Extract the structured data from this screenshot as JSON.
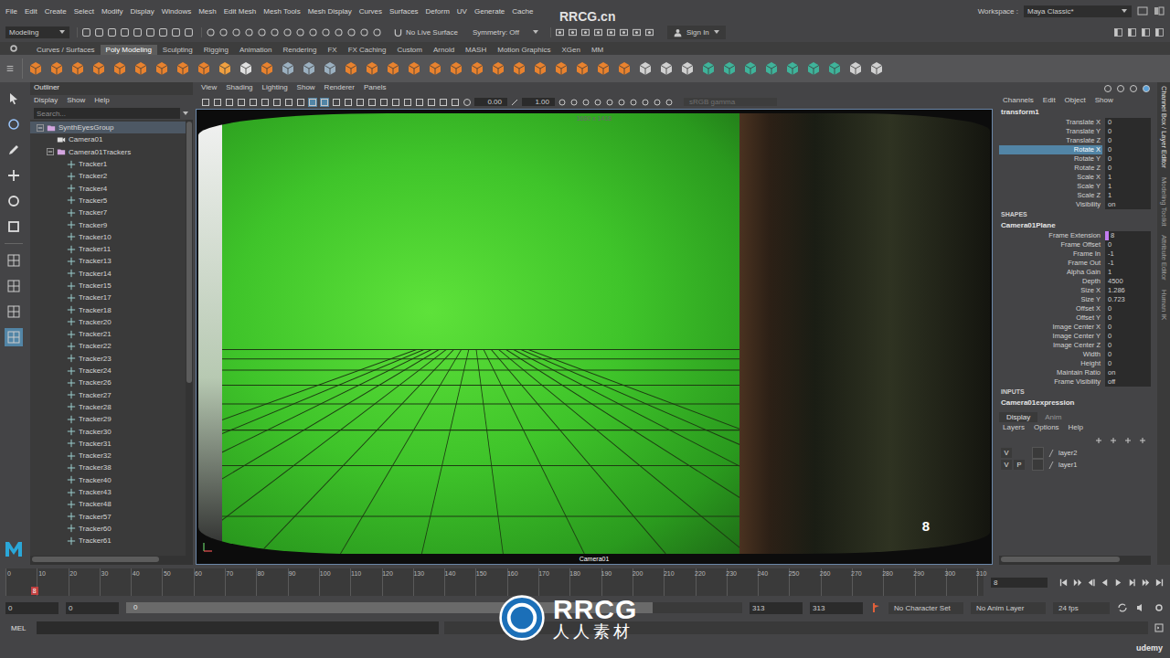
{
  "menubar": {
    "items": [
      "File",
      "Edit",
      "Create",
      "Select",
      "Modify",
      "Display",
      "Windows",
      "Mesh",
      "Edit Mesh",
      "Mesh Tools",
      "Mesh Display",
      "Curves",
      "Surfaces",
      "Deform",
      "UV",
      "Generate",
      "Cache"
    ],
    "workspace_label": "Workspace :",
    "workspace": "Maya Classic*"
  },
  "statusline": {
    "mode": "Modeling",
    "live_surface": "No Live Surface",
    "symmetry": "Symmetry: Off",
    "sign_in": "Sign In"
  },
  "shelf_tabs": [
    {
      "label": "Curves / Surfaces",
      "selected": false
    },
    {
      "label": "Poly Modeling",
      "selected": true
    },
    {
      "label": "Sculpting",
      "selected": false
    },
    {
      "label": "Rigging",
      "selected": false
    },
    {
      "label": "Animation",
      "selected": false
    },
    {
      "label": "Rendering",
      "selected": false
    },
    {
      "label": "FX",
      "selected": false
    },
    {
      "label": "FX Caching",
      "selected": false
    },
    {
      "label": "Custom",
      "selected": false
    },
    {
      "label": "Arnold",
      "selected": false
    },
    {
      "label": "MASH",
      "selected": false
    },
    {
      "label": "Motion Graphics",
      "selected": false
    },
    {
      "label": "XGen",
      "selected": false
    },
    {
      "label": "MM",
      "selected": false
    }
  ],
  "outliner": {
    "title": "Outliner",
    "menu": [
      "Display",
      "Show",
      "Help"
    ],
    "search_placeholder": "Search...",
    "items": [
      {
        "label": "SynthEyesGroup",
        "depth": 0,
        "kind": "group",
        "expanded": true,
        "selected": true
      },
      {
        "label": "Camera01",
        "depth": 1,
        "kind": "camera",
        "expanded": false,
        "selected": false
      },
      {
        "label": "Camera01Trackers",
        "depth": 1,
        "kind": "group",
        "expanded": true,
        "selected": false
      },
      {
        "label": "Tracker1",
        "depth": 2,
        "kind": "locator",
        "expanded": false,
        "selected": false
      },
      {
        "label": "Tracker2",
        "depth": 2,
        "kind": "locator",
        "expanded": false,
        "selected": false
      },
      {
        "label": "Tracker4",
        "depth": 2,
        "kind": "locator",
        "expanded": false,
        "selected": false
      },
      {
        "label": "Tracker5",
        "depth": 2,
        "kind": "locator",
        "expanded": false,
        "selected": false
      },
      {
        "label": "Tracker7",
        "depth": 2,
        "kind": "locator",
        "expanded": false,
        "selected": false
      },
      {
        "label": "Tracker9",
        "depth": 2,
        "kind": "locator",
        "expanded": false,
        "selected": false
      },
      {
        "label": "Tracker10",
        "depth": 2,
        "kind": "locator",
        "expanded": false,
        "selected": false
      },
      {
        "label": "Tracker11",
        "depth": 2,
        "kind": "locator",
        "expanded": false,
        "selected": false
      },
      {
        "label": "Tracker13",
        "depth": 2,
        "kind": "locator",
        "expanded": false,
        "selected": false
      },
      {
        "label": "Tracker14",
        "depth": 2,
        "kind": "locator",
        "expanded": false,
        "selected": false
      },
      {
        "label": "Tracker15",
        "depth": 2,
        "kind": "locator",
        "expanded": false,
        "selected": false
      },
      {
        "label": "Tracker17",
        "depth": 2,
        "kind": "locator",
        "expanded": false,
        "selected": false
      },
      {
        "label": "Tracker18",
        "depth": 2,
        "kind": "locator",
        "expanded": false,
        "selected": false
      },
      {
        "label": "Tracker20",
        "depth": 2,
        "kind": "locator",
        "expanded": false,
        "selected": false
      },
      {
        "label": "Tracker21",
        "depth": 2,
        "kind": "locator",
        "expanded": false,
        "selected": false
      },
      {
        "label": "Tracker22",
        "depth": 2,
        "kind": "locator",
        "expanded": false,
        "selected": false
      },
      {
        "label": "Tracker23",
        "depth": 2,
        "kind": "locator",
        "expanded": false,
        "selected": false
      },
      {
        "label": "Tracker24",
        "depth": 2,
        "kind": "locator",
        "expanded": false,
        "selected": false
      },
      {
        "label": "Tracker26",
        "depth": 2,
        "kind": "locator",
        "expanded": false,
        "selected": false
      },
      {
        "label": "Tracker27",
        "depth": 2,
        "kind": "locator",
        "expanded": false,
        "selected": false
      },
      {
        "label": "Tracker28",
        "depth": 2,
        "kind": "locator",
        "expanded": false,
        "selected": false
      },
      {
        "label": "Tracker29",
        "depth": 2,
        "kind": "locator",
        "expanded": false,
        "selected": false
      },
      {
        "label": "Tracker30",
        "depth": 2,
        "kind": "locator",
        "expanded": false,
        "selected": false
      },
      {
        "label": "Tracker31",
        "depth": 2,
        "kind": "locator",
        "expanded": false,
        "selected": false
      },
      {
        "label": "Tracker32",
        "depth": 2,
        "kind": "locator",
        "expanded": false,
        "selected": false
      },
      {
        "label": "Tracker38",
        "depth": 2,
        "kind": "locator",
        "expanded": false,
        "selected": false
      },
      {
        "label": "Tracker40",
        "depth": 2,
        "kind": "locator",
        "expanded": false,
        "selected": false
      },
      {
        "label": "Tracker43",
        "depth": 2,
        "kind": "locator",
        "expanded": false,
        "selected": false
      },
      {
        "label": "Tracker48",
        "depth": 2,
        "kind": "locator",
        "expanded": false,
        "selected": false
      },
      {
        "label": "Tracker57",
        "depth": 2,
        "kind": "locator",
        "expanded": false,
        "selected": false
      },
      {
        "label": "Tracker60",
        "depth": 2,
        "kind": "locator",
        "expanded": false,
        "selected": false
      },
      {
        "label": "Tracker61",
        "depth": 2,
        "kind": "locator",
        "expanded": false,
        "selected": false
      }
    ]
  },
  "viewport": {
    "menu": [
      "View",
      "Shading",
      "Lighting",
      "Show",
      "Renderer",
      "Panels"
    ],
    "exposure": "0.00",
    "gamma": "1.00",
    "color_space": "sRGB gamma",
    "resolution": "1680 x 1418",
    "camera": "Camera01",
    "frame": "8"
  },
  "channel_box": {
    "menu": [
      "Channels",
      "Edit",
      "Object",
      "Show"
    ],
    "node": "transform1",
    "attributes": [
      {
        "name": "Translate X",
        "value": "0",
        "selected": false,
        "driven": false
      },
      {
        "name": "Translate Y",
        "value": "0",
        "selected": false,
        "driven": false
      },
      {
        "name": "Translate Z",
        "value": "0",
        "selected": false,
        "driven": false
      },
      {
        "name": "Rotate X",
        "value": "0",
        "selected": true,
        "driven": false
      },
      {
        "name": "Rotate Y",
        "value": "0",
        "selected": false,
        "driven": false
      },
      {
        "name": "Rotate Z",
        "value": "0",
        "selected": false,
        "driven": false
      },
      {
        "name": "Scale X",
        "value": "1",
        "selected": false,
        "driven": false
      },
      {
        "name": "Scale Y",
        "value": "1",
        "selected": false,
        "driven": false
      },
      {
        "name": "Scale Z",
        "value": "1",
        "selected": false,
        "driven": false
      },
      {
        "name": "Visibility",
        "value": "on",
        "selected": false,
        "driven": false
      }
    ],
    "shapes_header": "SHAPES",
    "shape": "Camera01Plane",
    "shape_attributes": [
      {
        "name": "Frame Extension",
        "value": "8",
        "selected": false,
        "driven": true
      },
      {
        "name": "Frame Offset",
        "value": "0",
        "selected": false,
        "driven": false
      },
      {
        "name": "Frame In",
        "value": "-1",
        "selected": false,
        "driven": false
      },
      {
        "name": "Frame Out",
        "value": "-1",
        "selected": false,
        "driven": false
      },
      {
        "name": "Alpha Gain",
        "value": "1",
        "selected": false,
        "driven": false
      },
      {
        "name": "Depth",
        "value": "4500",
        "selected": false,
        "driven": false
      },
      {
        "name": "Size X",
        "value": "1.286",
        "selected": false,
        "driven": false
      },
      {
        "name": "Size Y",
        "value": "0.723",
        "selected": false,
        "driven": false
      },
      {
        "name": "Offset X",
        "value": "0",
        "selected": false,
        "driven": false
      },
      {
        "name": "Offset Y",
        "value": "0",
        "selected": false,
        "driven": false
      },
      {
        "name": "Image Center X",
        "value": "0",
        "selected": false,
        "driven": false
      },
      {
        "name": "Image Center Y",
        "value": "0",
        "selected": false,
        "driven": false
      },
      {
        "name": "Image Center Z",
        "value": "0",
        "selected": false,
        "driven": false
      },
      {
        "name": "Width",
        "value": "0",
        "selected": false,
        "driven": false
      },
      {
        "name": "Height",
        "value": "0",
        "selected": false,
        "driven": false
      },
      {
        "name": "Maintain Ratio",
        "value": "on",
        "selected": false,
        "driven": false
      },
      {
        "name": "Frame Visibility",
        "value": "off",
        "selected": false,
        "driven": false
      }
    ],
    "inputs_header": "INPUTS",
    "input": "Camera01expression"
  },
  "side_tabs": [
    "Channel Box / Layer Editor",
    "Modeling Toolkit",
    "Attribute Editor",
    "Human IK"
  ],
  "layer_editor": {
    "tabs": [
      {
        "label": "Display",
        "selected": true
      },
      {
        "label": "Anim",
        "selected": false
      }
    ],
    "menu": [
      "Layers",
      "Options",
      "Help"
    ],
    "layers": [
      {
        "name": "layer2",
        "toggles": [
          "V"
        ]
      },
      {
        "name": "layer1",
        "toggles": [
          "V",
          "P"
        ]
      }
    ]
  },
  "time_slider": {
    "ticks": [
      "0",
      "10",
      "20",
      "30",
      "40",
      "50",
      "60",
      "70",
      "80",
      "90",
      "100",
      "110",
      "120",
      "130",
      "140",
      "150",
      "160",
      "170",
      "180",
      "190",
      "200",
      "210",
      "220",
      "230",
      "240",
      "250",
      "260",
      "270",
      "280",
      "290",
      "300",
      "310"
    ],
    "playhead": {
      "label": "8",
      "level": 0.026
    },
    "current_frame": "8"
  },
  "range_slider": {
    "anim_start": "0",
    "playback_start": "0",
    "bar_label": "0",
    "playback_end": "313",
    "anim_end": "313",
    "character_set": "No Character Set",
    "anim_layer": "No Anim Layer",
    "fps": "24 fps"
  },
  "command_line": {
    "language": "MEL"
  },
  "watermarks": {
    "top": "RRCG.cn",
    "brand": "RRCG",
    "brand_cn": "人人素材",
    "platform": "udemy"
  }
}
